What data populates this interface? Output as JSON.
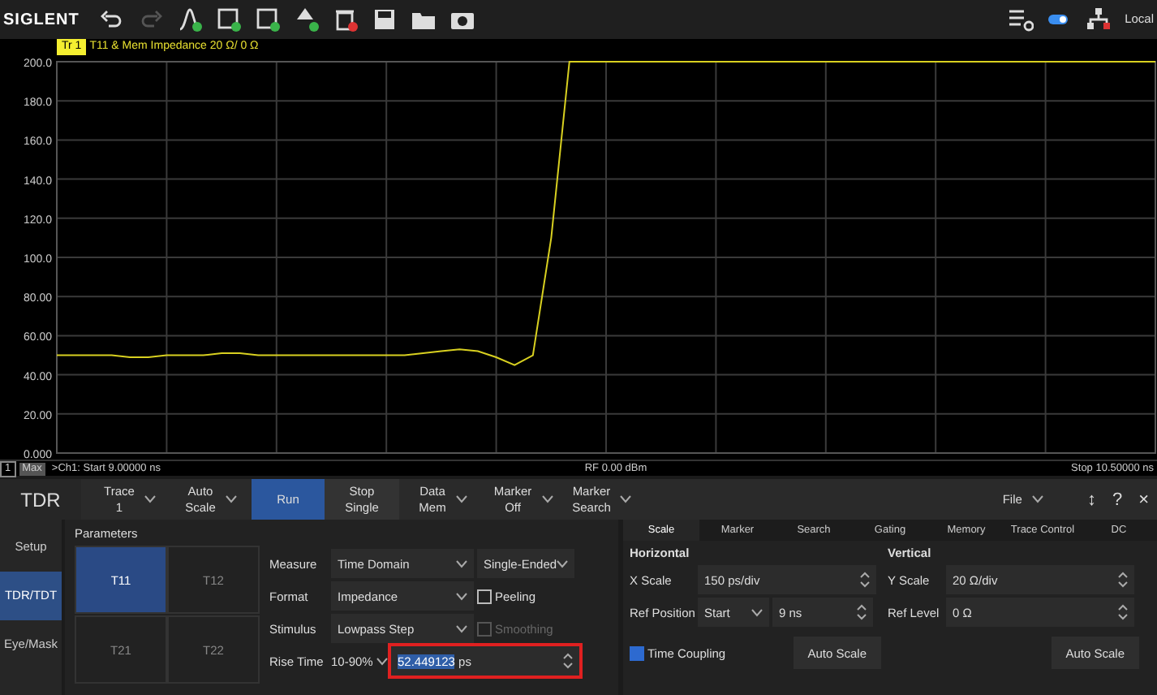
{
  "toolbar": {
    "logo": "SIGLENT",
    "status": "Local"
  },
  "chart": {
    "trace_badge": "Tr 1",
    "header": "T11 & Mem Impedance 20 Ω/ 0 Ω",
    "chart_data": {
      "type": "line",
      "grid": true,
      "ylim": [
        0,
        200
      ],
      "yticks": [
        {
          "value": 200,
          "label": "200.0"
        },
        {
          "value": 180,
          "label": "180.0"
        },
        {
          "value": 160,
          "label": "160.0"
        },
        {
          "value": 140,
          "label": "140.0"
        },
        {
          "value": 120,
          "label": "120.0"
        },
        {
          "value": 100,
          "label": "100.0"
        },
        {
          "value": 80,
          "label": "80.00"
        },
        {
          "value": 60,
          "label": "60.00"
        },
        {
          "value": 40,
          "label": "40.00"
        },
        {
          "value": 20,
          "label": "20.00"
        },
        {
          "value": 0,
          "label": "0.000"
        }
      ],
      "categories": [
        null,
        null,
        null,
        null,
        null,
        null,
        null,
        null,
        null,
        null,
        null,
        null,
        null,
        null,
        null,
        null,
        null,
        null,
        null,
        null,
        null,
        null,
        null,
        null,
        null,
        null,
        null,
        null,
        null,
        null,
        null,
        null,
        null,
        null,
        null,
        null,
        null,
        null,
        null,
        null,
        null,
        null,
        null,
        null,
        null,
        null,
        null,
        null,
        null,
        null,
        null,
        null,
        null,
        null,
        null,
        null,
        null,
        null,
        null,
        null,
        null
      ],
      "series": [
        {
          "color": "#d8d020",
          "values": [
            50,
            50,
            50,
            50,
            49,
            49,
            50,
            50,
            50,
            51,
            51,
            50,
            50,
            50,
            50,
            50,
            50,
            50,
            50,
            50,
            51,
            52,
            53,
            52,
            49,
            45,
            50,
            110,
            200,
            200,
            200,
            200,
            200,
            200,
            200,
            200,
            200,
            200,
            200,
            200,
            200,
            200,
            200,
            200,
            200,
            200,
            200,
            200,
            200,
            200,
            200,
            200,
            200,
            200,
            200,
            200,
            200,
            200,
            200,
            200,
            200
          ]
        }
      ]
    }
  },
  "footer": {
    "channel": "1",
    "mode": "Max",
    "start": ">Ch1: Start 9.00000 ns",
    "power": "RF 0.00 dBm",
    "stop": "Stop 10.50000 ns"
  },
  "softkeys": [
    {
      "kind": "title",
      "lines": [
        "TDR"
      ]
    },
    {
      "kind": "dropdown",
      "lines": [
        "Trace",
        "1"
      ],
      "highlighted": false
    },
    {
      "kind": "dropdown",
      "lines": [
        "Auto",
        "Scale"
      ],
      "highlighted": false
    },
    {
      "kind": "button",
      "lines": [
        "Run"
      ],
      "highlighted": true
    },
    {
      "kind": "button",
      "lines": [
        "Stop",
        "Single"
      ],
      "highlighted": false
    },
    {
      "kind": "dropdown",
      "lines": [
        "Data",
        "Mem"
      ],
      "highlighted": false
    },
    {
      "kind": "dropdown",
      "lines": [
        "Marker",
        "Off"
      ],
      "highlighted": false
    },
    {
      "kind": "dropdown",
      "lines": [
        "Marker",
        "Search"
      ],
      "highlighted": false
    }
  ],
  "window_controls": [
    {
      "kind": "dropdown",
      "label": "File"
    },
    {
      "kind": "glyph",
      "label": "↕"
    },
    {
      "kind": "glyph",
      "label": "?"
    },
    {
      "kind": "glyph",
      "label": "×"
    }
  ],
  "side_tabs": [
    {
      "label": "Setup",
      "selected": false
    },
    {
      "label": "TDR/TDT",
      "selected": true
    },
    {
      "label": "Eye/Mask",
      "selected": false
    }
  ],
  "parameters": {
    "title": "Parameters",
    "ports": [
      {
        "label": "T11",
        "selected": true
      },
      {
        "label": "T12",
        "selected": false
      },
      {
        "label": "T21",
        "selected": false
      },
      {
        "label": "T22",
        "selected": false
      }
    ],
    "rows": [
      {
        "kind": "select",
        "label": "Measure",
        "value": "Time Domain",
        "extra": {
          "kind": "select",
          "value": "Single-Ended"
        }
      },
      {
        "kind": "select",
        "label": "Format",
        "value": "Impedance",
        "extra": {
          "kind": "checkbox",
          "label": "Peeling",
          "checked": false,
          "disabled": false
        }
      },
      {
        "kind": "select",
        "label": "Stimulus",
        "value": "Lowpass Step",
        "extra": {
          "kind": "checkbox",
          "label": "Smoothing",
          "checked": false,
          "disabled": true
        }
      },
      {
        "kind": "spin",
        "label": "Rise Time",
        "value": "10-90%",
        "input": "52.449123",
        "unit": "ps",
        "highlighted": true
      }
    ]
  },
  "tabs": [
    {
      "label": "Scale",
      "selected": true
    },
    {
      "label": "Marker",
      "selected": false
    },
    {
      "label": "Search",
      "selected": false
    },
    {
      "label": "Gating",
      "selected": false
    },
    {
      "label": "Memory",
      "selected": false
    },
    {
      "label": "Trace Control",
      "selected": false
    },
    {
      "label": "DC",
      "selected": false
    }
  ],
  "horizontal": {
    "title": "Horizontal",
    "x_scale": {
      "label": "X Scale",
      "value": "150 ps/div"
    },
    "ref_position": {
      "label": "Ref Position",
      "mode": "Start",
      "value": "9 ns"
    },
    "time_coupling": {
      "label": "Time Coupling",
      "checked": true
    },
    "button": "Auto Scale"
  },
  "vertical": {
    "title": "Vertical",
    "y_scale": {
      "label": "Y Scale",
      "value": "20 Ω/div"
    },
    "ref_level": {
      "label": "Ref Level",
      "value": "0 Ω"
    },
    "button": "Auto Scale"
  }
}
